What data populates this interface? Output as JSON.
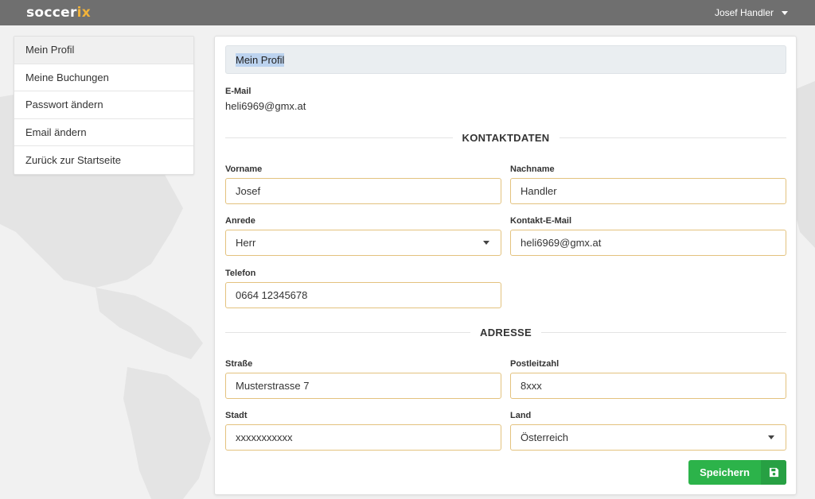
{
  "brand": {
    "logo_main": "soccer",
    "logo_accent": "ix"
  },
  "user_menu": {
    "name": "Josef Handler"
  },
  "sidebar": {
    "items": [
      {
        "label": "Mein Profil",
        "active": true
      },
      {
        "label": "Meine Buchungen"
      },
      {
        "label": "Passwort ändern"
      },
      {
        "label": "Email ändern"
      },
      {
        "label": "Zurück zur Startseite"
      }
    ]
  },
  "panel": {
    "title": "Mein Profil",
    "email_label": "E-Mail",
    "email_value": "heli6969@gmx.at",
    "contact_section": "KONTAKTDATEN",
    "address_section": "ADRESSE",
    "fields": {
      "vorname": {
        "label": "Vorname",
        "value": "Josef"
      },
      "nachname": {
        "label": "Nachname",
        "value": "Handler"
      },
      "anrede": {
        "label": "Anrede",
        "value": "Herr"
      },
      "kontakt_email": {
        "label": "Kontakt-E-Mail",
        "value": "heli6969@gmx.at"
      },
      "telefon": {
        "label": "Telefon",
        "value": "0664 12345678"
      },
      "strasse": {
        "label": "Straße",
        "value": "Musterstrasse 7"
      },
      "plz": {
        "label": "Postleitzahl",
        "value": "8xxx"
      },
      "stadt": {
        "label": "Stadt",
        "value": "xxxxxxxxxxx"
      },
      "land": {
        "label": "Land",
        "value": "Österreich"
      }
    },
    "save_label": "Speichern"
  },
  "colors": {
    "navbar": "#6f6f6f",
    "accent": "#f2b33a",
    "field_border": "#e3c27e",
    "save_button": "#2cb34a"
  },
  "icons": {
    "save": "floppy-disk-icon",
    "dropdown": "caret-down-icon"
  }
}
